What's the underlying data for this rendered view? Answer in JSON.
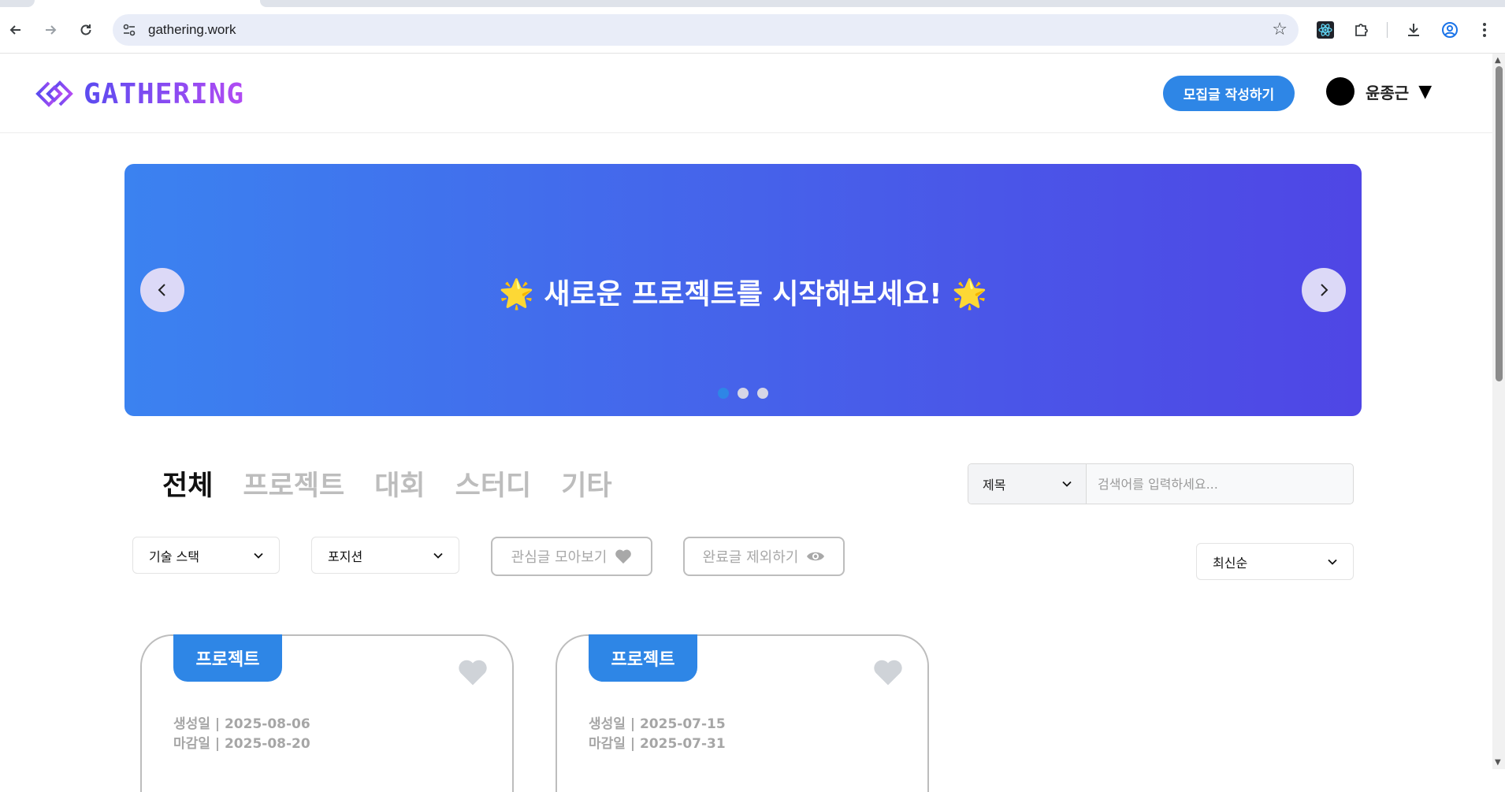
{
  "browser": {
    "url": "gathering.work"
  },
  "header": {
    "logo_text": "GATHERING",
    "write_button": "모집글 작성하기",
    "user_name": "윤종근"
  },
  "banner": {
    "text": "🌟 새로운 프로젝트를 시작해보세요! 🌟",
    "slide_count": 3,
    "active_slide": 1,
    "gradient": [
      "#3b82f0",
      "#4f46e5"
    ]
  },
  "categories": [
    {
      "label": "전체",
      "active": true
    },
    {
      "label": "프로젝트",
      "active": false
    },
    {
      "label": "대회",
      "active": false
    },
    {
      "label": "스터디",
      "active": false
    },
    {
      "label": "기타",
      "active": false
    }
  ],
  "search": {
    "field_label": "제목",
    "placeholder": "검색어를 입력하세요..."
  },
  "filters": {
    "tech_stack": "기술 스택",
    "position": "포지션",
    "bookmark_toggle": "관심글 모아보기",
    "hide_completed_toggle": "완료글 제외하기",
    "sort": "최신순"
  },
  "cards": [
    {
      "category": "프로젝트",
      "created": "생성일 | 2025-08-06",
      "deadline": "마감일 | 2025-08-20"
    },
    {
      "category": "프로젝트",
      "created": "생성일 | 2025-07-15",
      "deadline": "마감일 | 2025-07-31"
    }
  ],
  "colors": {
    "accent": "#2e86e6",
    "logo_gradient": [
      "#5b4bf0",
      "#b24bf3"
    ],
    "muted": "#bdbdbd"
  }
}
